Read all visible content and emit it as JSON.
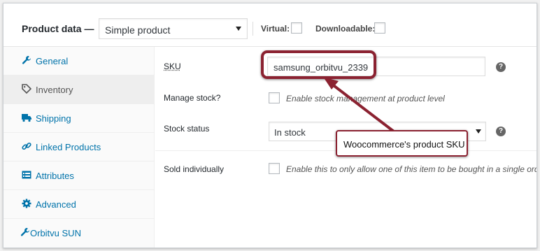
{
  "header": {
    "title": "Product data —",
    "product_type": "Simple product",
    "virtual_label": "Virtual:",
    "downloadable_label": "Downloadable:"
  },
  "sidebar": {
    "items": [
      {
        "label": "General",
        "icon": "wrench-icon"
      },
      {
        "label": "Inventory",
        "icon": "tag-icon",
        "active": true
      },
      {
        "label": "Shipping",
        "icon": "truck-icon"
      },
      {
        "label": "Linked Products",
        "icon": "link-icon"
      },
      {
        "label": "Attributes",
        "icon": "list-icon"
      },
      {
        "label": "Advanced",
        "icon": "gear-icon"
      },
      {
        "label": "Orbitvu SUN",
        "icon": "wrench-icon"
      }
    ]
  },
  "inventory": {
    "sku_label": "SKU",
    "sku_value": "samsung_orbitvu_2339",
    "manage_stock_label": "Manage stock?",
    "manage_stock_desc": "Enable stock management at product level",
    "stock_status_label": "Stock status",
    "stock_status_value": "In stock",
    "sold_individually_label": "Sold individually",
    "sold_individually_desc": "Enable this to only allow one of this item to be bought in a single order",
    "help_glyph": "?"
  },
  "annotation": {
    "callout_text": "Woocommerce's product SKU",
    "color": "#8b2231"
  },
  "colors": {
    "link": "#0073aa",
    "active_tab_bg": "#eeeeee"
  }
}
